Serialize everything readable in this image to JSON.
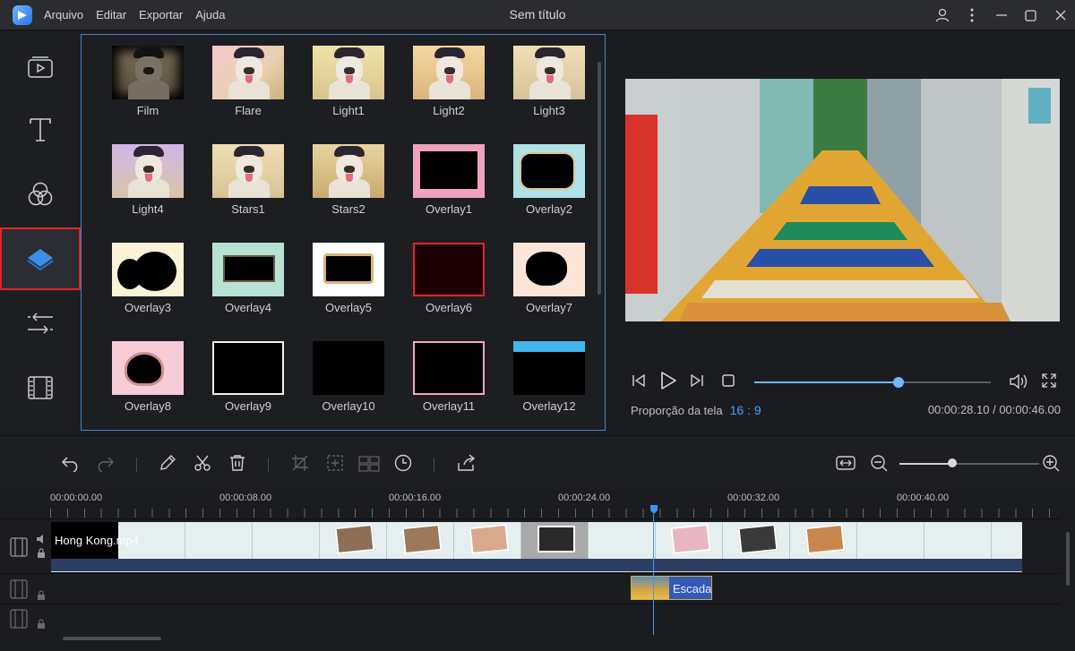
{
  "app": {
    "title": "Sem título",
    "logo": "app-logo-icon"
  },
  "menu": {
    "items": [
      "Arquivo",
      "Editar",
      "Exportar",
      "Ajuda"
    ]
  },
  "window_controls": [
    "account-icon",
    "more-icon",
    "minimize-icon",
    "maximize-icon",
    "close-icon"
  ],
  "sidebar": {
    "items": [
      {
        "name": "media-icon"
      },
      {
        "name": "text-icon"
      },
      {
        "name": "filters-icon"
      },
      {
        "name": "overlays-icon",
        "active": true
      },
      {
        "name": "transitions-icon"
      },
      {
        "name": "elements-icon"
      }
    ]
  },
  "effects": {
    "items": [
      "Film",
      "Flare",
      "Light1",
      "Light2",
      "Light3",
      "Light4",
      "Stars1",
      "Stars2",
      "Overlay1",
      "Overlay2",
      "Overlay3",
      "Overlay4",
      "Overlay5",
      "Overlay6",
      "Overlay7",
      "Overlay8",
      "Overlay9",
      "Overlay10",
      "Overlay11",
      "Overlay12"
    ]
  },
  "preview": {
    "ratio_label": "Proporção da tela",
    "ratio_value": "16 : 9",
    "timecode": "00:00:28.10 / 00:00:46.00",
    "progress": 0.61
  },
  "timeline": {
    "ruler": [
      "00:00:00.00",
      "00:00:08.00",
      "00:00:16.00",
      "00:00:24.00",
      "00:00:32.00",
      "00:00:40.00"
    ],
    "video_clip": "Hong Kong.mp4",
    "overlay_clip": "Escada",
    "zoom": 0.38
  },
  "colors": {
    "accent": "#3a97ff",
    "active_border": "#e0252b",
    "panel_border": "#3f86c8"
  }
}
